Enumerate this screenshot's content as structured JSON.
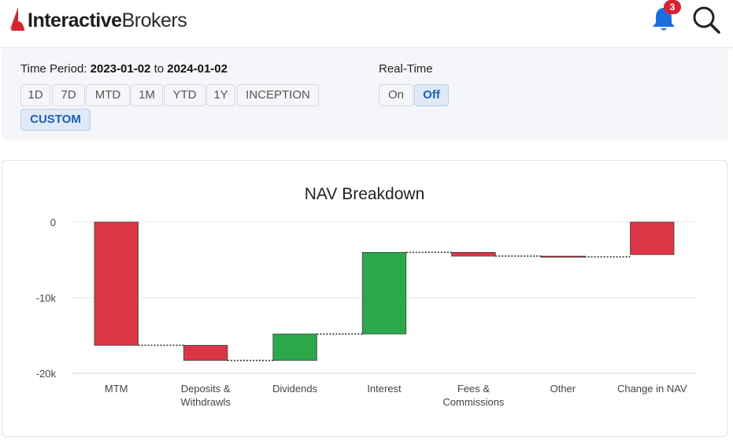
{
  "header": {
    "brand_bold": "Interactive",
    "brand_light": "Brokers",
    "notification_count": "3",
    "icons": [
      "logo-icon",
      "bell-icon",
      "search-icon"
    ],
    "brand_color": "#d62330"
  },
  "filters": {
    "time_period_label": "Time Period:",
    "start_date": "2023-01-02",
    "to_label": "to",
    "end_date": "2024-01-02",
    "period_buttons": [
      {
        "label": "1D",
        "active": false
      },
      {
        "label": "7D",
        "active": false
      },
      {
        "label": "MTD",
        "active": false
      },
      {
        "label": "1M",
        "active": false
      },
      {
        "label": "YTD",
        "active": false
      },
      {
        "label": "1Y",
        "active": false
      },
      {
        "label": "INCEPTION",
        "active": false
      },
      {
        "label": "CUSTOM",
        "active": true
      }
    ],
    "realtime_label": "Real-Time",
    "realtime_buttons": [
      {
        "label": "On",
        "active": false
      },
      {
        "label": "Off",
        "active": true
      }
    ]
  },
  "chart_data": {
    "type": "bar",
    "subtype": "waterfall",
    "title": "NAV Breakdown",
    "xlabel": "",
    "ylabel": "",
    "categories": [
      "MTM",
      "Deposits & Withdrawls",
      "Dividends",
      "Interest",
      "Fees & Commissions",
      "Other",
      "Change in NAV"
    ],
    "category_lines": [
      [
        "MTM"
      ],
      [
        "Deposits &",
        "Withdrawls"
      ],
      [
        "Dividends"
      ],
      [
        "Interest"
      ],
      [
        "Fees &",
        "Commissions"
      ],
      [
        "Other"
      ],
      [
        "Change in NAV"
      ]
    ],
    "values": [
      -16300,
      -2000,
      3500,
      10800,
      -500,
      -100,
      -4300
    ],
    "total_index": 6,
    "ylim": [
      -20000,
      0
    ],
    "yticks": [
      0,
      -10000,
      -20000
    ],
    "ytick_labels": [
      "0",
      "-10k",
      "-20k"
    ],
    "grid": true,
    "legend": "none",
    "colors": {
      "positive": "#2aa84a",
      "negative": "#dc3545",
      "connector": "#333333",
      "grid": "#e6e6e6"
    }
  }
}
